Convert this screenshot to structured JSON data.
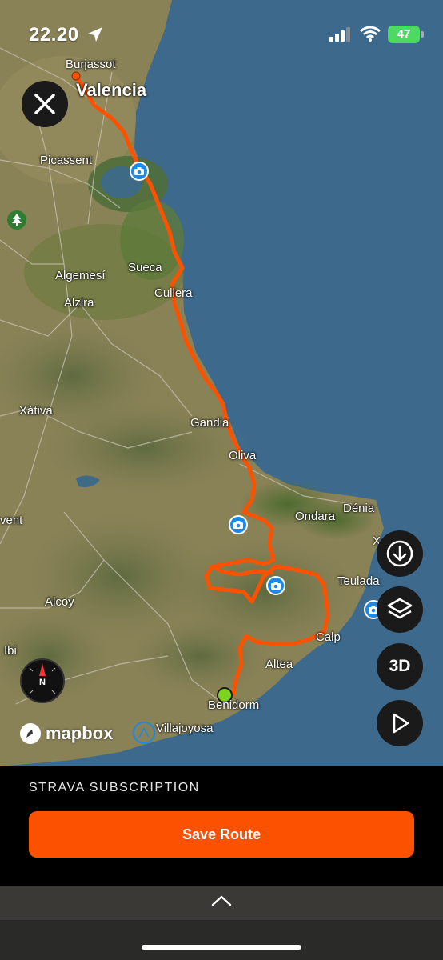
{
  "status_bar": {
    "time": "22.20",
    "battery": "47"
  },
  "map": {
    "places": {
      "burjassot": "Burjassot",
      "valencia": "Valencia",
      "picassent": "Picassent",
      "sueca": "Sueca",
      "algemesi": "Algemesí",
      "alzira": "Alzira",
      "cullera": "Cullera",
      "xativa": "Xàtiva",
      "gandia": "Gandia",
      "oliva": "Oliva",
      "ondara": "Ondara",
      "denia": "Dénia",
      "xabia": "X",
      "ontinyent": "vent",
      "teulada": "Teulada",
      "alcoy": "Alcoy",
      "calp": "Calp",
      "altea": "Altea",
      "ibi": "Ibi",
      "benidorm": "Benidorm",
      "villajoyosa": "Villajoyosa"
    },
    "attribution": "mapbox",
    "compass_label": "N",
    "controls": {
      "three_d_label": "3D"
    },
    "colors": {
      "route": "#fc5200",
      "sea": "#3d6a8c",
      "photo_marker": "#1e88e5",
      "start_marker": "#7ed321"
    }
  },
  "panel": {
    "subscription_label": "STRAVA SUBSCRIPTION",
    "save_label": "Save Route"
  }
}
